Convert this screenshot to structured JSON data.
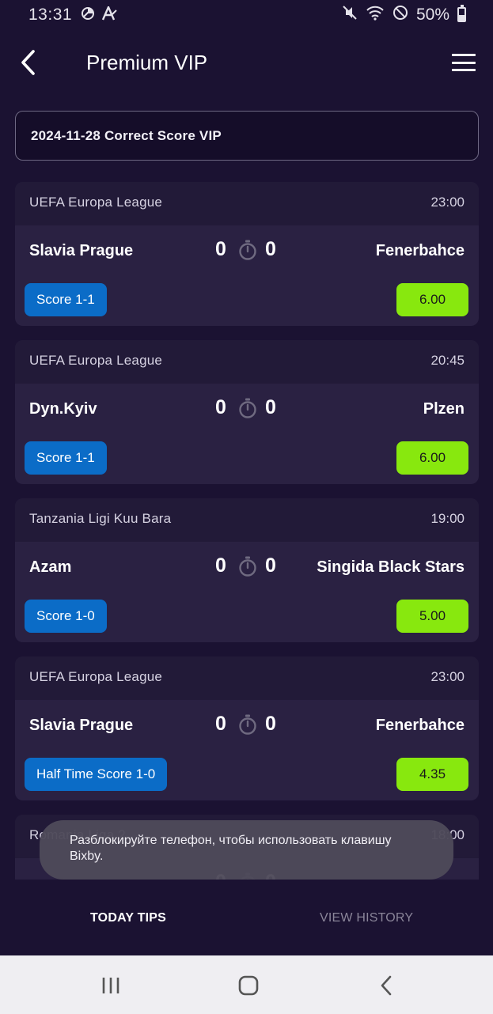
{
  "status_bar": {
    "time": "13:31",
    "battery": "50%",
    "battery_level": 0.5,
    "icons": [
      "data-saver-icon",
      "font-a-icon",
      "mute-icon",
      "wifi-icon",
      "do-not-disturb-icon",
      "battery-icon"
    ]
  },
  "header": {
    "title": "Premium VIP",
    "back_icon": "back-arrow-icon",
    "menu_icon": "hamburger-menu-icon"
  },
  "title_box": {
    "text": "2024-11-28 Correct Score VIP"
  },
  "matches": [
    {
      "league": "UEFA Europa League",
      "time": "23:00",
      "home": "Slavia Prague",
      "away": "Fenerbahce",
      "score_home": "0",
      "score_away": "0",
      "tip": "Score 1-1",
      "odds": "6.00"
    },
    {
      "league": "UEFA Europa League",
      "time": "20:45",
      "home": "Dyn.Kyiv",
      "away": "Plzen",
      "score_home": "0",
      "score_away": "0",
      "tip": "Score 1-1",
      "odds": "6.00"
    },
    {
      "league": "Tanzania Ligi Kuu Bara",
      "time": "19:00",
      "home": "Azam",
      "away": "Singida Black Stars",
      "score_home": "0",
      "score_away": "0",
      "tip": "Score 1-0",
      "odds": "5.00"
    },
    {
      "league": "UEFA Europa League",
      "time": "23:00",
      "home": "Slavia Prague",
      "away": "Fenerbahce",
      "score_home": "0",
      "score_away": "0",
      "tip": "Half Time Score 1-0",
      "odds": "4.35"
    },
    {
      "league": "Romania Liga 2",
      "time": "18:00",
      "home": "",
      "away": "",
      "score_home": "0",
      "score_away": "0",
      "tip": "",
      "odds": ""
    }
  ],
  "toast": {
    "text": "Разблокируйте телефон, чтобы использовать клавишу Bixby."
  },
  "tabs": {
    "today": "TODAY TIPS",
    "history": "VIEW HISTORY",
    "active": "today"
  },
  "nav_bar": {
    "icons": [
      "recent-apps-icon",
      "home-icon",
      "back-icon"
    ]
  },
  "colors": {
    "background": "#1b1232",
    "card": "#2a2142",
    "card_header": "#221a38",
    "tip_button": "#0b6cc7",
    "odds_button": "#88e80e"
  }
}
